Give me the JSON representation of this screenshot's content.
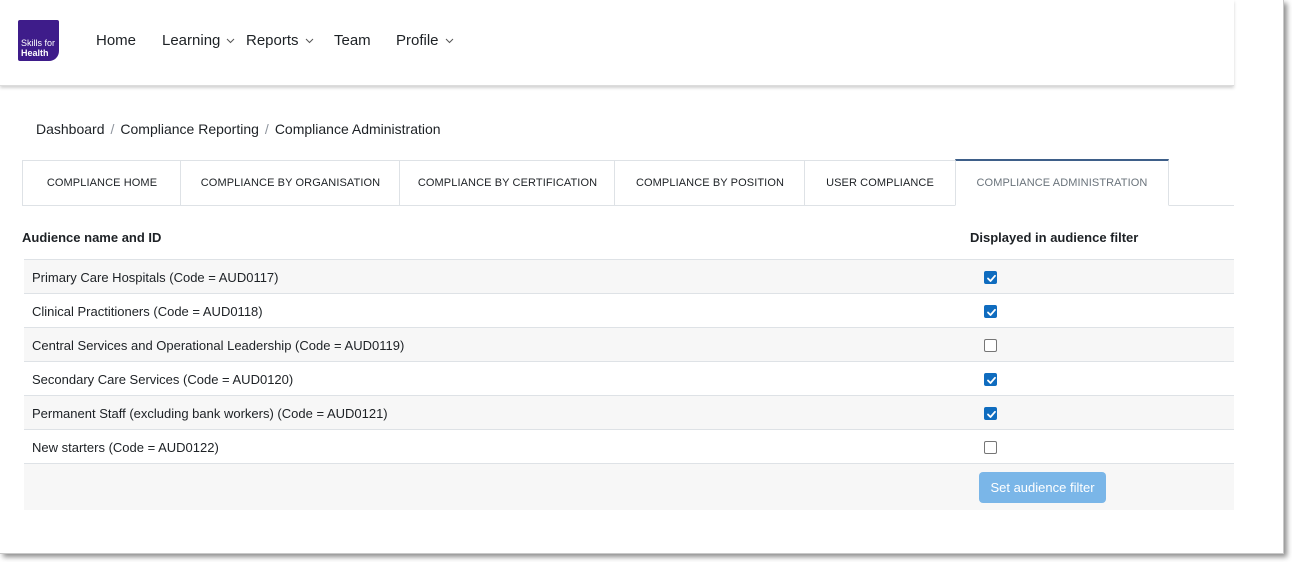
{
  "logo": {
    "line1": "Skills for",
    "line2": "Health",
    "brand_color": "#3e1c8a"
  },
  "nav": {
    "items": [
      {
        "label": "Home",
        "has_dropdown": false
      },
      {
        "label": "Learning",
        "has_dropdown": true
      },
      {
        "label": "Reports",
        "has_dropdown": true
      },
      {
        "label": "Team",
        "has_dropdown": false
      },
      {
        "label": "Profile",
        "has_dropdown": true
      }
    ]
  },
  "breadcrumb": {
    "items": [
      "Dashboard",
      "Compliance Reporting",
      "Compliance Administration"
    ],
    "separator": "/"
  },
  "tabs": [
    {
      "label": "COMPLIANCE HOME",
      "active": false
    },
    {
      "label": "COMPLIANCE BY ORGANISATION",
      "active": false
    },
    {
      "label": "COMPLIANCE BY CERTIFICATION",
      "active": false
    },
    {
      "label": "COMPLIANCE BY POSITION",
      "active": false
    },
    {
      "label": "USER COMPLIANCE",
      "active": false
    },
    {
      "label": "COMPLIANCE ADMINISTRATION",
      "active": true
    }
  ],
  "table": {
    "columns": [
      "Audience name and ID",
      "Displayed in audience filter"
    ],
    "rows": [
      {
        "name": "Primary Care Hospitals (Code = AUD0117)",
        "checked": true
      },
      {
        "name": "Clinical Practitioners (Code = AUD0118)",
        "checked": true
      },
      {
        "name": "Central Services and Operational Leadership (Code = AUD0119)",
        "checked": false
      },
      {
        "name": "Secondary Care Services (Code = AUD0120)",
        "checked": true
      },
      {
        "name": "Permanent Staff (excluding bank workers) (Code = AUD0121)",
        "checked": true
      },
      {
        "name": "New starters (Code = AUD0122)",
        "checked": false
      }
    ]
  },
  "actions": {
    "set_filter_label": "Set audience filter",
    "button_color": "#7ab6e8"
  },
  "colors": {
    "checkbox_checked": "#0f6cbf",
    "active_tab_border": "#3e5f89"
  }
}
